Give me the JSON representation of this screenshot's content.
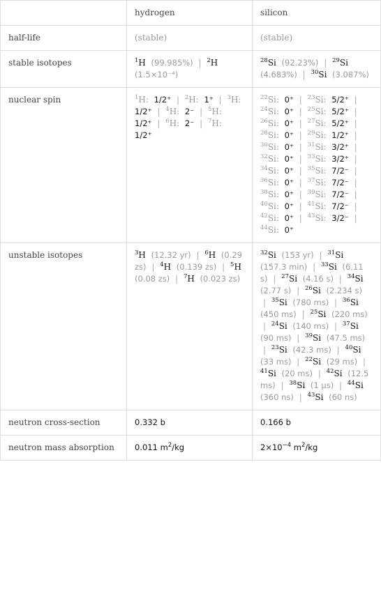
{
  "table": {
    "columns": [
      "",
      "hydrogen",
      "silicon"
    ],
    "rows": [
      {
        "label": "half-life",
        "hydrogen": "(stable)",
        "silicon": "(stable)"
      },
      {
        "label": "stable isotopes",
        "hydrogen": [
          {
            "mass": "1",
            "symbol": "H",
            "value": "(99.985%)"
          },
          {
            "mass": "2",
            "symbol": "H",
            "value": "(1.5×10⁻⁴)"
          }
        ],
        "silicon": [
          {
            "mass": "28",
            "symbol": "Si",
            "value": "(92.23%)"
          },
          {
            "mass": "29",
            "symbol": "Si",
            "value": "(4.683%)"
          },
          {
            "mass": "30",
            "symbol": "Si",
            "value": "(3.087%)"
          }
        ]
      },
      {
        "label": "nuclear spin",
        "hydrogen": [
          {
            "mass": "1",
            "symbol": "H",
            "spin": "1/2⁺"
          },
          {
            "mass": "2",
            "symbol": "H",
            "spin": "1⁺"
          },
          {
            "mass": "3",
            "symbol": "H",
            "spin": "1/2⁺"
          },
          {
            "mass": "4",
            "symbol": "H",
            "spin": "2⁻"
          },
          {
            "mass": "5",
            "symbol": "H",
            "spin": "1/2⁺"
          },
          {
            "mass": "6",
            "symbol": "H",
            "spin": "2⁻"
          },
          {
            "mass": "7",
            "symbol": "H",
            "spin": "1/2⁺"
          }
        ],
        "silicon": [
          {
            "mass": "22",
            "symbol": "Si",
            "spin": "0⁺"
          },
          {
            "mass": "23",
            "symbol": "Si",
            "spin": "5/2⁺"
          },
          {
            "mass": "24",
            "symbol": "Si",
            "spin": "0⁺"
          },
          {
            "mass": "25",
            "symbol": "Si",
            "spin": "5/2⁺"
          },
          {
            "mass": "26",
            "symbol": "Si",
            "spin": "0⁺"
          },
          {
            "mass": "27",
            "symbol": "Si",
            "spin": "5/2⁺"
          },
          {
            "mass": "28",
            "symbol": "Si",
            "spin": "0⁺"
          },
          {
            "mass": "29",
            "symbol": "Si",
            "spin": "1/2⁺"
          },
          {
            "mass": "30",
            "symbol": "Si",
            "spin": "0⁺"
          },
          {
            "mass": "31",
            "symbol": "Si",
            "spin": "3/2⁺"
          },
          {
            "mass": "32",
            "symbol": "Si",
            "spin": "0⁺"
          },
          {
            "mass": "33",
            "symbol": "Si",
            "spin": "3/2⁺"
          },
          {
            "mass": "34",
            "symbol": "Si",
            "spin": "0⁺"
          },
          {
            "mass": "35",
            "symbol": "Si",
            "spin": "7/2⁻"
          },
          {
            "mass": "36",
            "symbol": "Si",
            "spin": "0⁺"
          },
          {
            "mass": "37",
            "symbol": "Si",
            "spin": "7/2⁻"
          },
          {
            "mass": "38",
            "symbol": "Si",
            "spin": "0⁺"
          },
          {
            "mass": "39",
            "symbol": "Si",
            "spin": "7/2⁻"
          },
          {
            "mass": "40",
            "symbol": "Si",
            "spin": "0⁺"
          },
          {
            "mass": "41",
            "symbol": "Si",
            "spin": "7/2⁻"
          },
          {
            "mass": "42",
            "symbol": "Si",
            "spin": "0⁺"
          },
          {
            "mass": "43",
            "symbol": "Si",
            "spin": "3/2⁻"
          },
          {
            "mass": "44",
            "symbol": "Si",
            "spin": "0⁺"
          }
        ]
      },
      {
        "label": "unstable isotopes",
        "hydrogen": [
          {
            "mass": "3",
            "symbol": "H",
            "value": "(12.32 yr)"
          },
          {
            "mass": "6",
            "symbol": "H",
            "value": "(0.29 zs)"
          },
          {
            "mass": "4",
            "symbol": "H",
            "value": "(0.139 zs)"
          },
          {
            "mass": "5",
            "symbol": "H",
            "value": "(0.08 zs)"
          },
          {
            "mass": "7",
            "symbol": "H",
            "value": "(0.023 zs)"
          }
        ],
        "silicon": [
          {
            "mass": "32",
            "symbol": "Si",
            "value": "(153 yr)"
          },
          {
            "mass": "31",
            "symbol": "Si",
            "value": "(157.3 min)"
          },
          {
            "mass": "33",
            "symbol": "Si",
            "value": "(6.11 s)"
          },
          {
            "mass": "27",
            "symbol": "Si",
            "value": "(4.16 s)"
          },
          {
            "mass": "34",
            "symbol": "Si",
            "value": "(2.77 s)"
          },
          {
            "mass": "26",
            "symbol": "Si",
            "value": "(2.234 s)"
          },
          {
            "mass": "35",
            "symbol": "Si",
            "value": "(780 ms)"
          },
          {
            "mass": "36",
            "symbol": "Si",
            "value": "(450 ms)"
          },
          {
            "mass": "25",
            "symbol": "Si",
            "value": "(220 ms)"
          },
          {
            "mass": "24",
            "symbol": "Si",
            "value": "(140 ms)"
          },
          {
            "mass": "37",
            "symbol": "Si",
            "value": "(90 ms)"
          },
          {
            "mass": "39",
            "symbol": "Si",
            "value": "(47.5 ms)"
          },
          {
            "mass": "23",
            "symbol": "Si",
            "value": "(42.3 ms)"
          },
          {
            "mass": "40",
            "symbol": "Si",
            "value": "(33 ms)"
          },
          {
            "mass": "22",
            "symbol": "Si",
            "value": "(29 ms)"
          },
          {
            "mass": "41",
            "symbol": "Si",
            "value": "(20 ms)"
          },
          {
            "mass": "42",
            "symbol": "Si",
            "value": "(12.5 ms)"
          },
          {
            "mass": "38",
            "symbol": "Si",
            "value": "(1 µs)"
          },
          {
            "mass": "44",
            "symbol": "Si",
            "value": "(360 ns)"
          },
          {
            "mass": "43",
            "symbol": "Si",
            "value": "(60 ns)"
          }
        ]
      },
      {
        "label": "neutron cross-section",
        "hydrogen": "0.332 b",
        "silicon": "0.166 b"
      },
      {
        "label": "neutron mass absorption",
        "hydrogen": {
          "mantissa": "0.011",
          "exponent": "",
          "unit": "m",
          "unit_exp": "2",
          "unit_tail": "/kg"
        },
        "silicon": {
          "mantissa": "2×10",
          "exponent": "−4",
          "unit": "m",
          "unit_exp": "2",
          "unit_tail": "/kg"
        }
      }
    ],
    "separator": "|"
  }
}
